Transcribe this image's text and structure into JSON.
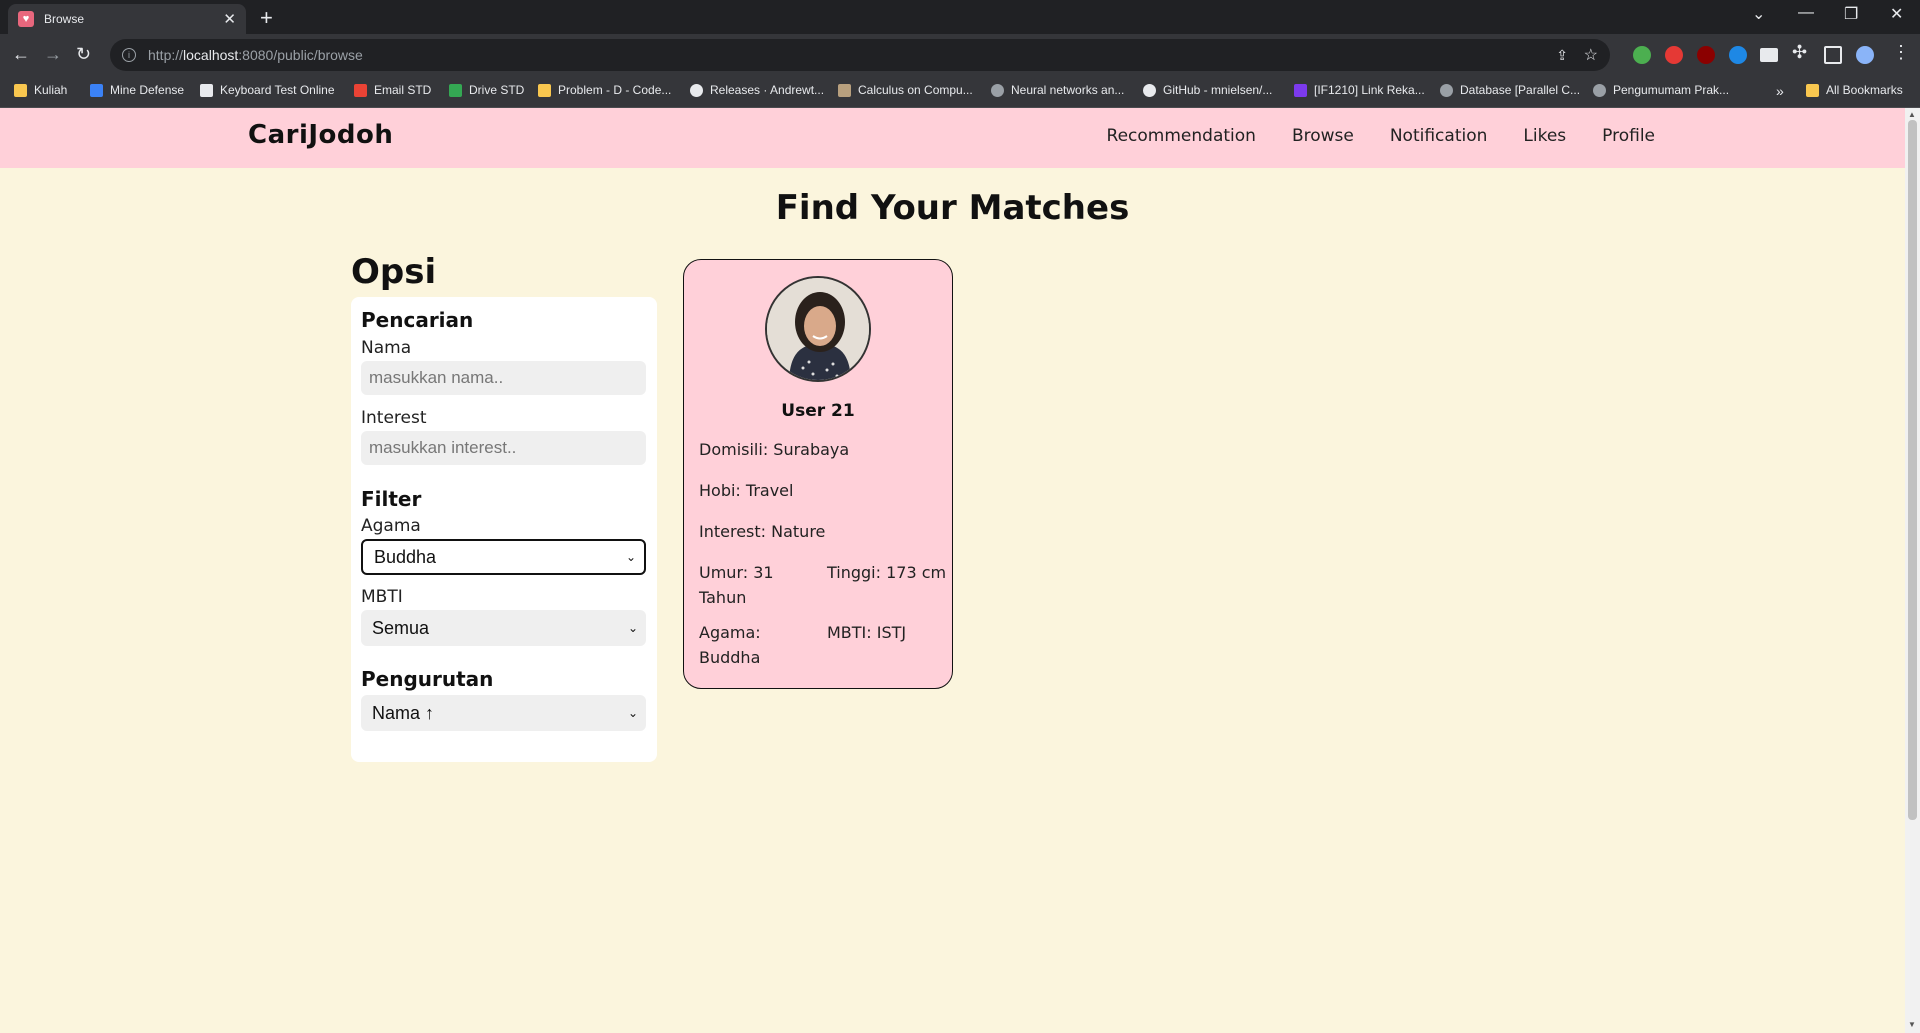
{
  "browser": {
    "tab_title": "Browse",
    "url_prefix": "http://",
    "url_host": "localhost",
    "url_rest": ":8080/public/browse",
    "bookmarks": [
      {
        "label": "Kuliah",
        "color": "#f9c74f"
      },
      {
        "label": "Mine Defense",
        "color": "#3b82f6"
      },
      {
        "label": "Keyboard Test Online",
        "color": "#e8eaed"
      },
      {
        "label": "Email STD",
        "color": "#ea4335"
      },
      {
        "label": "Drive STD",
        "color": "#34a853"
      },
      {
        "label": "Problem - D - Code...",
        "color": "#f9c74f"
      },
      {
        "label": "Releases · Andrewt...",
        "color": "#e8eaed"
      },
      {
        "label": "Calculus on Compu...",
        "color": "#b8a07e"
      },
      {
        "label": "Neural networks an...",
        "color": "#9aa0a6"
      },
      {
        "label": "GitHub - mnielsen/...",
        "color": "#e8eaed"
      },
      {
        "label": "[IF1210] Link Reka...",
        "color": "#7c3aed"
      },
      {
        "label": "Database [Parallel C...",
        "color": "#9aa0a6"
      },
      {
        "label": "Pengumumam Prak...",
        "color": "#9aa0a6"
      }
    ],
    "all_bookmarks": "All Bookmarks"
  },
  "nav": {
    "brand": "CariJodoh",
    "links": [
      "Recommendation",
      "Browse",
      "Notification",
      "Likes",
      "Profile"
    ]
  },
  "page": {
    "title": "Find Your Matches"
  },
  "options": {
    "title": "Opsi",
    "search_section": "Pencarian",
    "name_label": "Nama",
    "name_placeholder": "masukkan nama..",
    "interest_label": "Interest",
    "interest_placeholder": "masukkan interest..",
    "filter_section": "Filter",
    "religion_label": "Agama",
    "religion_value": "Buddha",
    "mbti_label": "MBTI",
    "mbti_value": "Semua",
    "sort_section": "Pengurutan",
    "sort_value": "Nama ↑"
  },
  "profile_card": {
    "name": "User 21",
    "domisili": "Domisili: Surabaya",
    "hobi": "Hobi: Travel",
    "interest": "Interest: Nature",
    "umur": "Umur: 31 Tahun",
    "tinggi": "Tinggi: 173 cm",
    "agama": "Agama: Buddha",
    "mbti": "MBTI: ISTJ"
  }
}
